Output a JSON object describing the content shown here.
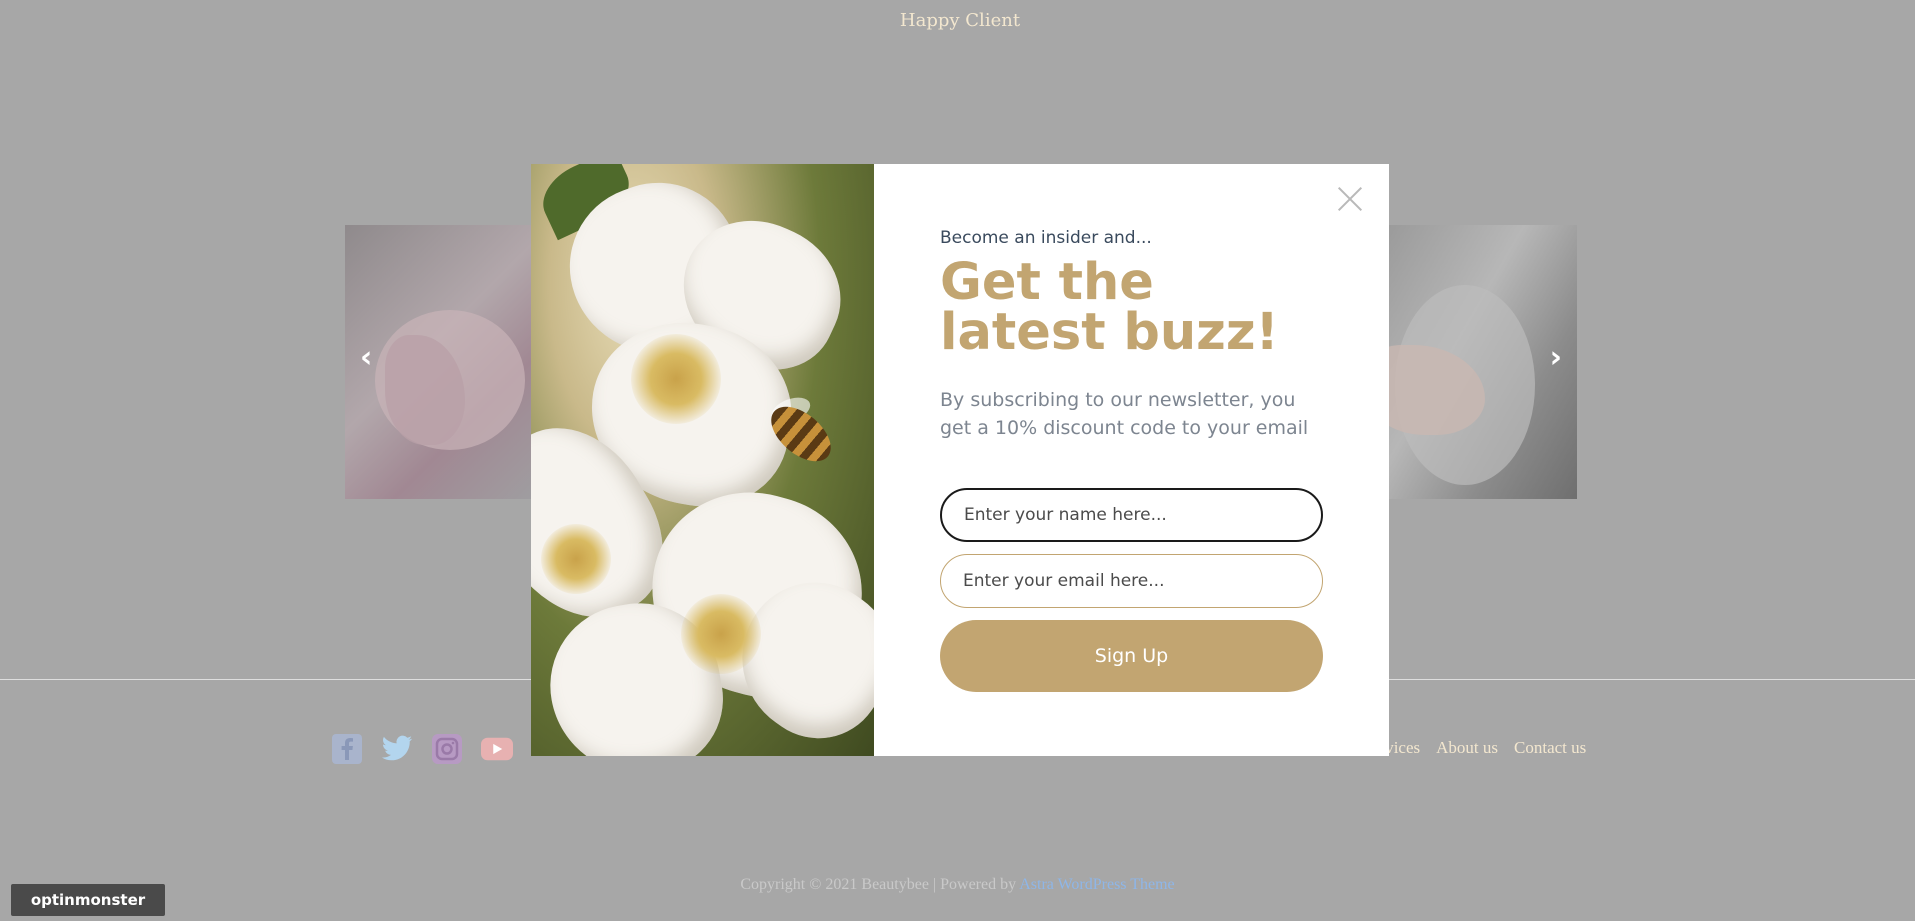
{
  "background": {
    "happy_client": "Happy Client",
    "footer_nav": [
      "ervices",
      "About us",
      "Contact us"
    ],
    "copyright_text": "Copyright © 2021 Beautybee | Powered by ",
    "copyright_link": "Astra WordPress Theme",
    "optinmonster_badge": "optinmonster",
    "social_icons": [
      "facebook-icon",
      "twitter-icon",
      "instagram-icon",
      "youtube-icon"
    ]
  },
  "modal": {
    "eyebrow": "Become an insider and...",
    "headline": "Get the latest buzz!",
    "subtext": "By subscribing to our newsletter, you get a 10% discount code to your email",
    "name_placeholder": "Enter your name here...",
    "email_placeholder": "Enter your email here...",
    "signup_label": "Sign Up"
  },
  "colors": {
    "accent": "#c2a571",
    "overlay": "#a7a7a7",
    "footer_text": "#f3e7cf"
  }
}
